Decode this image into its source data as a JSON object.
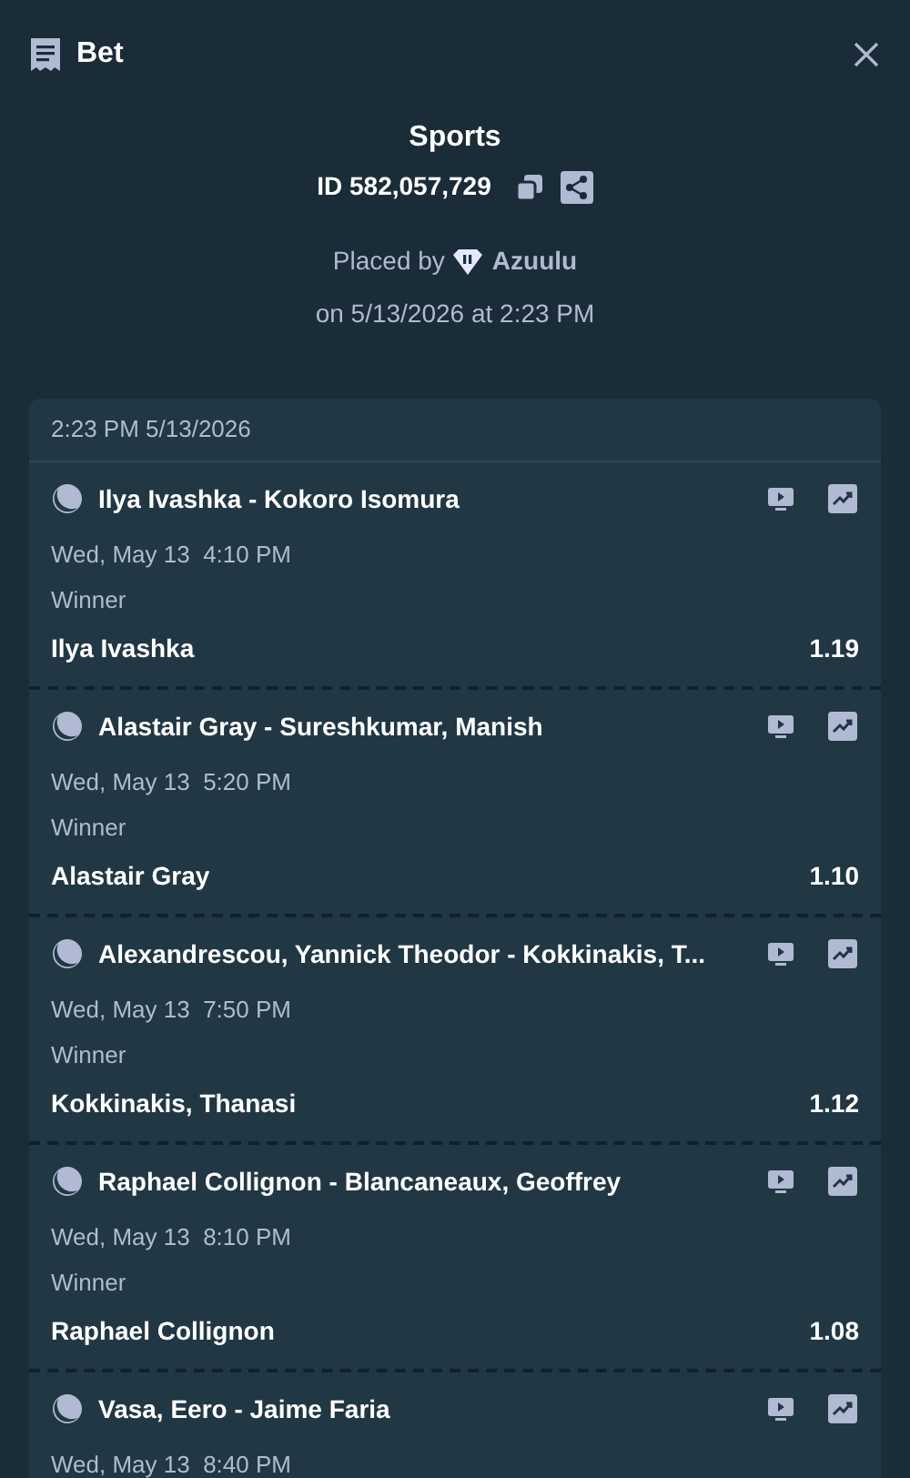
{
  "header": {
    "title": "Bet"
  },
  "summary": {
    "title": "Sports",
    "id_text": "ID **582,057,729**",
    "placed_by_label": "Placed by",
    "user": "Azuulu",
    "placed_on": "on 5/13/2026 at 2:23 PM"
  },
  "slip": {
    "timestamp": "2:23 PM 5/13/2026",
    "legs": [
      {
        "match": "Ilya Ivashka - Kokoro Isomura",
        "date": "Wed, May 13  4:10 PM",
        "market": "Winner",
        "selection": "Ilya Ivashka",
        "odds": "1.19"
      },
      {
        "match": "Alastair Gray - Sureshkumar, Manish",
        "date": "Wed, May 13  5:20 PM",
        "market": "Winner",
        "selection": "Alastair Gray",
        "odds": "1.10"
      },
      {
        "match": "Alexandrescou, Yannick Theodor - Kokkinakis, T...",
        "date": "Wed, May 13  7:50 PM",
        "market": "Winner",
        "selection": "Kokkinakis, Thanasi",
        "odds": "1.12"
      },
      {
        "match": "Raphael Collignon - Blancaneaux, Geoffrey",
        "date": "Wed, May 13  8:10 PM",
        "market": "Winner",
        "selection": "Raphael Collignon",
        "odds": "1.08"
      },
      {
        "match": "Vasa, Eero - Jaime Faria",
        "date": "Wed, May 13  8:40 PM"
      }
    ]
  }
}
